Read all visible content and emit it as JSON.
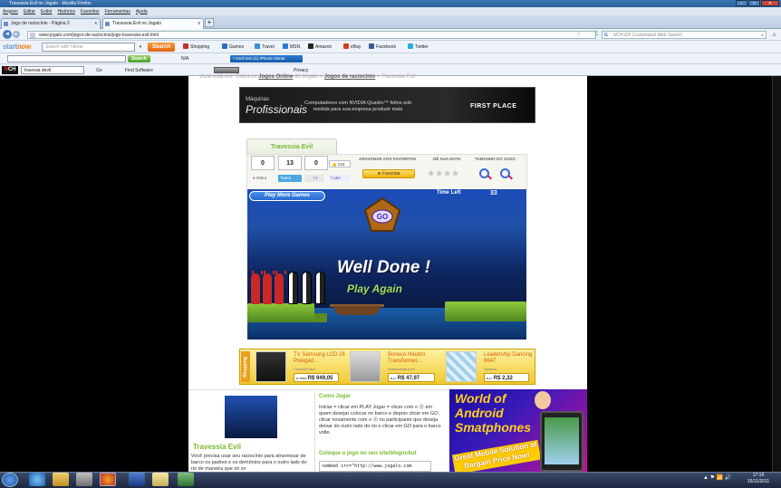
{
  "window": {
    "title": "Travessia Evil no Jogalo - Mozilla Firefox",
    "btn_min": "–",
    "btn_max": "□",
    "btn_close": "✕"
  },
  "menu": [
    "Arquivo",
    "Editar",
    "Exibir",
    "Histórico",
    "Favoritos",
    "Ferramentas",
    "Ajuda"
  ],
  "tabs": [
    {
      "label": "Jogo de raciocínio - Página 2"
    },
    {
      "label": "Travessia Evil no Jogalo"
    }
  ],
  "tab_close": "x",
  "new_tab": "+",
  "nav": {
    "back": "◄",
    "forward": "►",
    "url": "www.jogalo.com/jogos-de-raciocinio/jogo-travessia-evil.html",
    "search_placeholder": "NCH EN Customized Web Search",
    "search_g": "G",
    "reload": "C",
    "star": "☆",
    "mag": "⌕",
    "home": "⌂"
  },
  "toolbar1": {
    "brand_a": "start",
    "brand_b": "now",
    "yahoo_placeholder": "Search with Yahoo",
    "search_btn": "Search",
    "items": [
      "Shopping",
      "Games",
      "Travel",
      "MSN",
      "Amazon",
      "eBay",
      "Facebook",
      "Twitter"
    ],
    "colors": [
      "#c03030",
      "#2a70c0",
      "#3a90d0",
      "#2a7ad8",
      "#222222",
      "#d04020",
      "#3b5998",
      "#2aa9e0"
    ]
  },
  "toolbar2": {
    "search_btn": "Search",
    "na": "N/A",
    "iphone": "• Você tem (1) iPhone Alerta!"
  },
  "toolbar3": {
    "nch_a": "N",
    "nch_b": "CH",
    "query": "travesia devil",
    "go": "Go",
    "find": "Find Software",
    "privacy": "Privacy"
  },
  "breadcrumb": {
    "prefix": "Você está em:",
    "mid": "Todos os",
    "link1": "Jogos Online",
    "mid2": "do Jogalo >",
    "link2": "Jogos de raciocínio",
    "tail": "> Travessia Evil"
  },
  "banner_top": {
    "l1": "Máquinas",
    "l2": "Profissionais",
    "l3": "Computadores com NVIDIA Quadro™ feitos sob medida para sua empresa produzir mais",
    "l4": "FIRST PLACE"
  },
  "game_panel": {
    "title": "Travessia Evil",
    "count1": "0",
    "count2": "13",
    "count3": "0",
    "orkut": "Orkut",
    "tweet": "Tweet",
    "plus": "+1",
    "fb_count": "223",
    "like": "Like",
    "label_fav": "Adicionar aos favoritos",
    "label_rate": "Dê sua nota",
    "label_size": "Tamanho do jogo",
    "fav_btn": "Favoritar",
    "rating_stars": 5,
    "rating_value": 0
  },
  "game": {
    "play_more": "Play More Games",
    "time_label": "Time Left",
    "time_value": "33",
    "go": "GO",
    "well_done": "Well Done !",
    "play_again": "Play Again"
  },
  "shop": {
    "label": "Shopping",
    "items": [
      {
        "title": "TV Samsung LCD 26 Polegad...",
        "store": "Compra Fácil",
        "prefix": "à vista",
        "price": "R$ 949,05"
      },
      {
        "title": "Boneco Hasbro Transformer...",
        "store": "Americanas.com",
        "prefix": "a p.",
        "price": "R$ 47,97"
      },
      {
        "title": "Leadership Dancing 6647",
        "store": "Saraiva",
        "prefix": "a p.",
        "price": "R$ 2,32"
      }
    ]
  },
  "lower": {
    "game_title": "Travessia Evil",
    "desc": "Você precisa usar seu raciocínio para atravessar de barco os padres e os demônios para o outro lado do rio de maneira que só so",
    "how_title": "Como Jogar",
    "how_text": "Iniciar = clicar em PLAY Jogar = clicar com o ⓓ em quem desejar colocar no barco e depois clicar em GO, clicar novamente com o ⓓ no participante que deseja deixar do outro lado do rio e clicar em GO para o barco volte.",
    "embed_title": "Coloque o jogo no seu site/blog/orkut",
    "embed_code": "<embed src=\"http://www.jogalo.com"
  },
  "android_ad": {
    "l1": "World of",
    "l2": "Android",
    "l3": "Smatphones",
    "l4": "Great Mobile Solution at Bargain Price",
    "l5": "Now!"
  },
  "taskbar": {
    "tray": "▲ ⚑ 📶 🔊",
    "time": "17:19",
    "date": "15/11/2011"
  }
}
